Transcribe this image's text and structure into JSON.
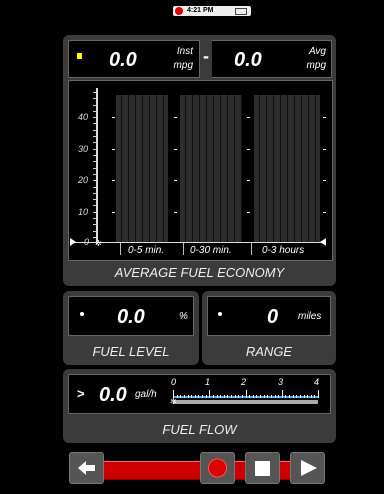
{
  "status": {
    "time": "4:21 PM"
  },
  "inst": {
    "value": "0.0",
    "unit_line1": "Inst",
    "unit_line2": "mpg"
  },
  "separator": "-",
  "avg": {
    "value": "0.0",
    "unit_line1": "Avg",
    "unit_line2": "mpg"
  },
  "chart": {
    "y_ticks": [
      "40",
      "30",
      "20",
      "10",
      "0"
    ],
    "periods": [
      "0-5 min.",
      "0-30 min.",
      "0-3 hours"
    ],
    "caption": "AVERAGE FUEL ECONOMY"
  },
  "fuel_level": {
    "value": "0.0",
    "unit": "%",
    "caption": "FUEL LEVEL"
  },
  "range": {
    "value": "0",
    "unit": "miles",
    "caption": "RANGE"
  },
  "fuel_flow": {
    "arrow": ">",
    "value": "0.0",
    "unit": "gal/h",
    "scale": [
      "0",
      "1",
      "2",
      "3",
      "4"
    ],
    "level": 0,
    "caption": "FUEL FLOW"
  },
  "controls": {
    "accent_color": "#cc0000"
  }
}
